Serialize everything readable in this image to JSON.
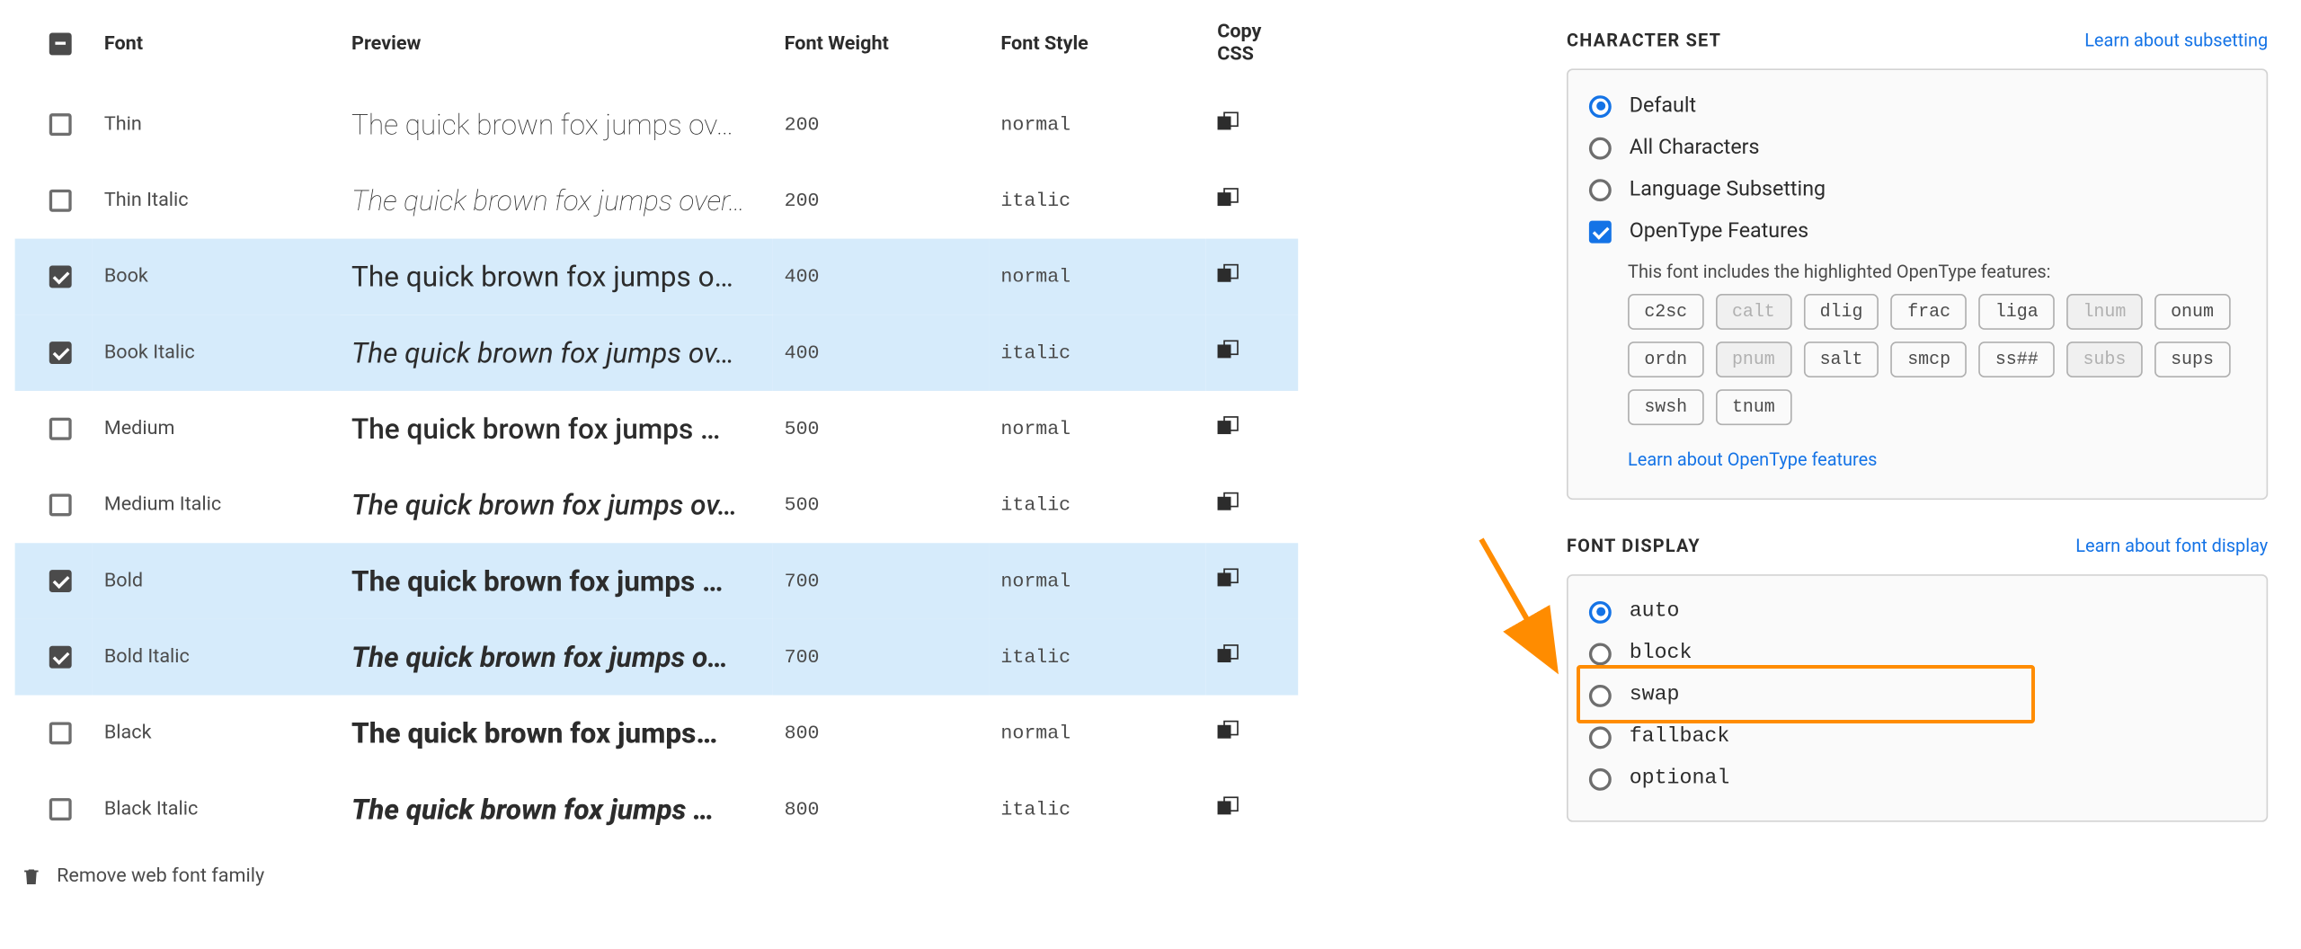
{
  "table": {
    "headers": {
      "font": "Font",
      "preview": "Preview",
      "weight": "Font Weight",
      "style": "Font Style",
      "copy": "Copy CSS"
    },
    "rows": [
      {
        "name": "Thin",
        "preview": "The quick brown fox jumps ov…",
        "weight": "200",
        "style": "normal",
        "checked": false,
        "italic": false,
        "wclass": "w100"
      },
      {
        "name": "Thin Italic",
        "preview": "The quick brown fox jumps over…",
        "weight": "200",
        "style": "italic",
        "checked": false,
        "italic": true,
        "wclass": "w100"
      },
      {
        "name": "Book",
        "preview": "The quick brown fox jumps o…",
        "weight": "400",
        "style": "normal",
        "checked": true,
        "italic": false,
        "wclass": "w400"
      },
      {
        "name": "Book Italic",
        "preview": "The quick brown fox jumps ov…",
        "weight": "400",
        "style": "italic",
        "checked": true,
        "italic": true,
        "wclass": "w400"
      },
      {
        "name": "Medium",
        "preview": "The quick brown fox jumps …",
        "weight": "500",
        "style": "normal",
        "checked": false,
        "italic": false,
        "wclass": "w500"
      },
      {
        "name": "Medium Italic",
        "preview": "The quick brown fox jumps ov…",
        "weight": "500",
        "style": "italic",
        "checked": false,
        "italic": true,
        "wclass": "w500"
      },
      {
        "name": "Bold",
        "preview": "The quick brown fox jumps …",
        "weight": "700",
        "style": "normal",
        "checked": true,
        "italic": false,
        "wclass": "w700"
      },
      {
        "name": "Bold Italic",
        "preview": "The quick brown fox jumps o…",
        "weight": "700",
        "style": "italic",
        "checked": true,
        "italic": true,
        "wclass": "w700"
      },
      {
        "name": "Black",
        "preview": "The quick brown fox jumps…",
        "weight": "800",
        "style": "normal",
        "checked": false,
        "italic": false,
        "wclass": "w800"
      },
      {
        "name": "Black Italic",
        "preview": "The quick brown fox jumps …",
        "weight": "800",
        "style": "italic",
        "checked": false,
        "italic": true,
        "wclass": "w800"
      }
    ]
  },
  "remove_label": "Remove web font family",
  "character_set": {
    "title": "CHARACTER SET",
    "learn": "Learn about subsetting",
    "options": [
      {
        "label": "Default",
        "type": "radio",
        "selected": true
      },
      {
        "label": "All Characters",
        "type": "radio",
        "selected": false
      },
      {
        "label": "Language Subsetting",
        "type": "radio",
        "selected": false
      },
      {
        "label": "OpenType Features",
        "type": "checkbox",
        "selected": true
      }
    ],
    "ot_note": "This font includes the highlighted OpenType features:",
    "tags": [
      {
        "label": "c2sc",
        "disabled": false
      },
      {
        "label": "calt",
        "disabled": true
      },
      {
        "label": "dlig",
        "disabled": false
      },
      {
        "label": "frac",
        "disabled": false
      },
      {
        "label": "liga",
        "disabled": false
      },
      {
        "label": "lnum",
        "disabled": true
      },
      {
        "label": "onum",
        "disabled": false
      },
      {
        "label": "ordn",
        "disabled": false
      },
      {
        "label": "pnum",
        "disabled": true
      },
      {
        "label": "salt",
        "disabled": false
      },
      {
        "label": "smcp",
        "disabled": false
      },
      {
        "label": "ss##",
        "disabled": false
      },
      {
        "label": "subs",
        "disabled": true
      },
      {
        "label": "sups",
        "disabled": false
      },
      {
        "label": "swsh",
        "disabled": false
      },
      {
        "label": "tnum",
        "disabled": false
      }
    ],
    "ot_learn": "Learn about OpenType features"
  },
  "font_display": {
    "title": "FONT DISPLAY",
    "learn": "Learn about font display",
    "options": [
      {
        "label": "auto",
        "selected": true
      },
      {
        "label": "block",
        "selected": false
      },
      {
        "label": "swap",
        "selected": false
      },
      {
        "label": "fallback",
        "selected": false
      },
      {
        "label": "optional",
        "selected": false
      }
    ]
  }
}
